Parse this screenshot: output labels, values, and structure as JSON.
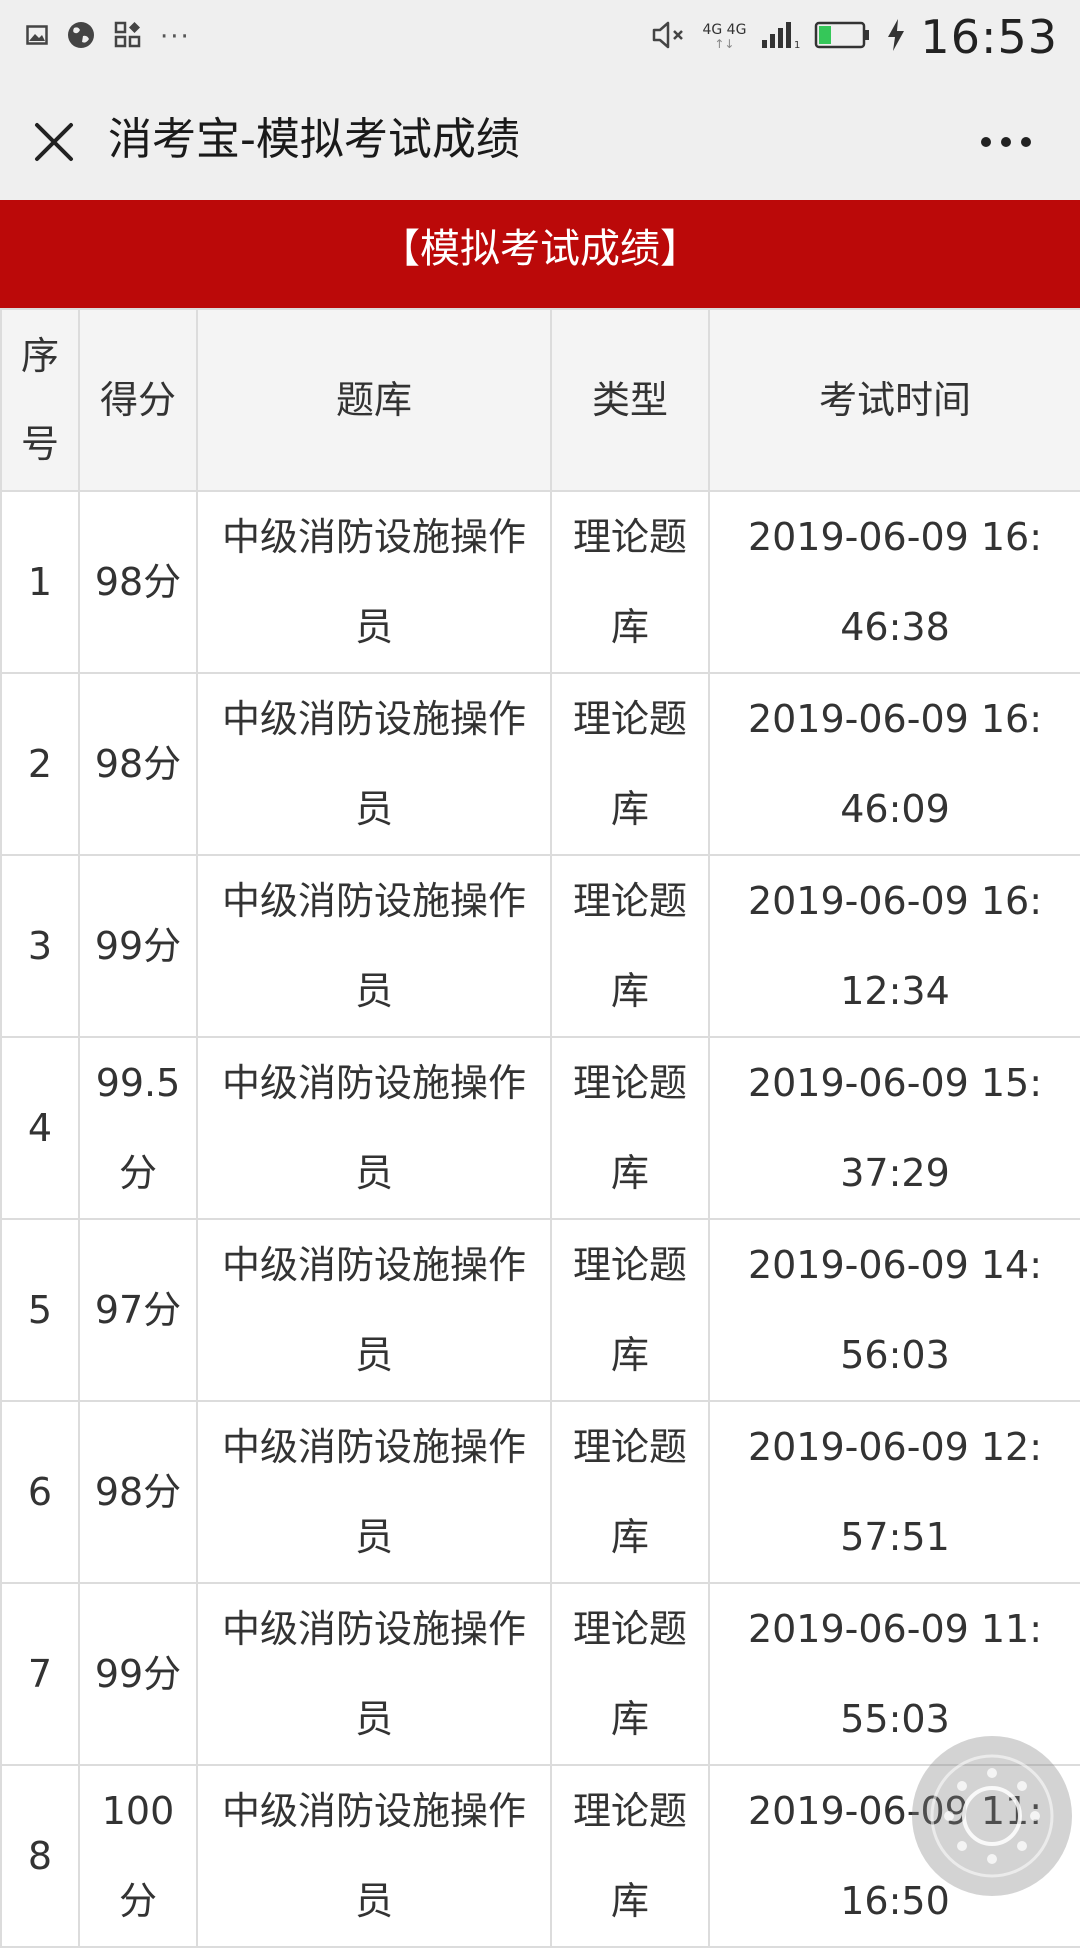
{
  "status_bar": {
    "time": "16:53",
    "left_icons": [
      "image-icon",
      "globe-icon",
      "apps-icon",
      "more-dots-icon"
    ],
    "more_dots": "···",
    "mute_icon": "speaker-mute-icon",
    "network_top": "4G 4G",
    "network_arrows": "↑↓",
    "signal_icon": "signal-bars-icon",
    "sim_index": "1",
    "battery_icon": "battery-icon",
    "charging_icon": "charging-bolt-icon",
    "battery_color": "#35c759"
  },
  "title_bar": {
    "title": "消考宝-模拟考试成绩",
    "close_icon": "close-icon",
    "more_icon": "more-icon"
  },
  "banner": {
    "text": "【模拟考试成绩】",
    "color": "#bb0909"
  },
  "table": {
    "headers": {
      "seq": "序号",
      "score": "得分",
      "bank": "题库",
      "type": "类型",
      "time": "考试时间"
    },
    "rows": [
      {
        "seq": "1",
        "score": "98分",
        "bank": "中级消防设施操作员",
        "type": "理论题库",
        "time": "2019-06-09 16:46:38"
      },
      {
        "seq": "2",
        "score": "98分",
        "bank": "中级消防设施操作员",
        "type": "理论题库",
        "time": "2019-06-09 16:46:09"
      },
      {
        "seq": "3",
        "score": "99分",
        "bank": "中级消防设施操作员",
        "type": "理论题库",
        "time": "2019-06-09 16:12:34"
      },
      {
        "seq": "4",
        "score": "99.5分",
        "bank": "中级消防设施操作员",
        "type": "理论题库",
        "time": "2019-06-09 15:37:29"
      },
      {
        "seq": "5",
        "score": "97分",
        "bank": "中级消防设施操作员",
        "type": "理论题库",
        "time": "2019-06-09 14:56:03"
      },
      {
        "seq": "6",
        "score": "98分",
        "bank": "中级消防设施操作员",
        "type": "理论题库",
        "time": "2019-06-09 12:57:51"
      },
      {
        "seq": "7",
        "score": "99分",
        "bank": "中级消防设施操作员",
        "type": "理论题库",
        "time": "2019-06-09 11:55:03"
      },
      {
        "seq": "8",
        "score": "100分",
        "bank": "中级消防设施操作员",
        "type": "理论题库",
        "time": "2019-06-09 11:16:50"
      }
    ]
  },
  "floating_ball": {
    "icon": "assistive-touch-icon"
  }
}
